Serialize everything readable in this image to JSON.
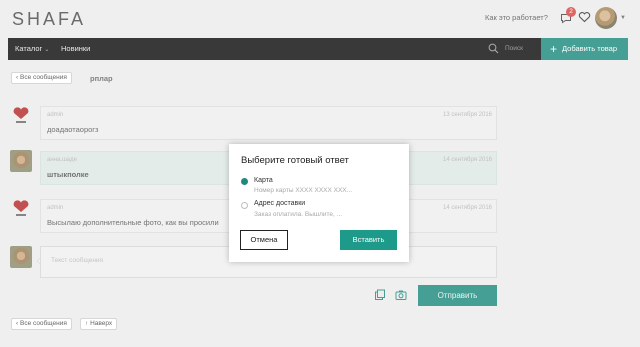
{
  "header": {
    "logo": "SHAFA",
    "how_it_works": "Как это работает?",
    "notifications_count": "2"
  },
  "nav": {
    "catalog": "Каталог",
    "news": "Новинки",
    "search_placeholder": "Поиск",
    "add_product": "Добавить товар"
  },
  "thread": {
    "back_label": "Все сообщения",
    "username": "рплар"
  },
  "messages": [
    {
      "author": "admin",
      "date": "13 сентября 2016",
      "text": "доадаотаорогз"
    },
    {
      "author": "анна.шаде",
      "date": "14 сентября 2016",
      "text": "штыкполке"
    },
    {
      "author": "admin",
      "date": "14 сентября 2016",
      "text": "Высылаю дополнительные фото, как вы просили"
    }
  ],
  "composer": {
    "placeholder": "Текст сообщения",
    "send_label": "Отправить"
  },
  "footer": {
    "back_label": "Все сообщения",
    "up_label": "Наверх"
  },
  "modal": {
    "title": "Выберите готовый ответ",
    "options": [
      {
        "label": "Карта",
        "preview": "Номер карты XXXX XXXX XXX...",
        "selected": true
      },
      {
        "label": "Адрес доставки",
        "preview": "Заказ оплатила. Вышлите, ...",
        "selected": false
      }
    ],
    "cancel_label": "Отмена",
    "insert_label": "Вставить"
  },
  "colors": {
    "accent": "#1d8a7d",
    "navbar": "#0e0e0e",
    "badge": "#d64541"
  }
}
